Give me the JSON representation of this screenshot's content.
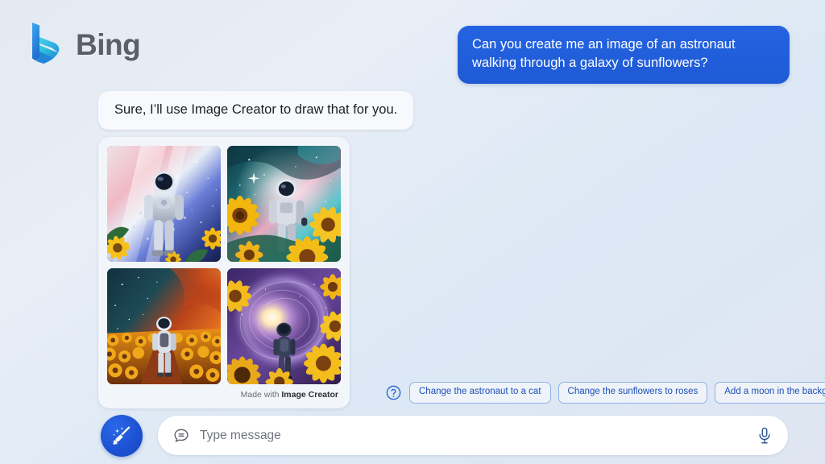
{
  "brand": {
    "name": "Bing",
    "logo_icon": "bing-b-logo"
  },
  "conversation": {
    "user_message": "Can you create me an image of an astronaut walking through a galaxy of sunflowers?",
    "bot_message": "Sure, I’ll use Image Creator to draw that for you."
  },
  "result_card": {
    "images": [
      {
        "alt": "astronaut-blue-pink-nebula-sunflowers",
        "palette": {
          "sky_a": "#f2e9ee",
          "sky_b": "#5566c8",
          "sky_c": "#1b2550",
          "accent": "#f5c518"
        }
      },
      {
        "alt": "astronaut-teal-pink-nebula-large-sunflowers",
        "palette": {
          "sky_a": "#12404a",
          "sky_b": "#52c3c9",
          "sky_c": "#e79ab8",
          "accent": "#f2b705"
        }
      },
      {
        "alt": "astronaut-orange-nebula-sunflower-field-path",
        "palette": {
          "sky_a": "#1c3a48",
          "sky_b": "#d9521a",
          "sky_c": "#7a1f10",
          "accent": "#f0a202"
        }
      },
      {
        "alt": "astronaut-purple-spiral-galaxy-portal-sunflowers",
        "palette": {
          "sky_a": "#4b2f79",
          "sky_b": "#b58adf",
          "sky_c": "#fdf4d8",
          "accent": "#f6c026"
        }
      }
    ],
    "footer_prefix": "Made with ",
    "footer_brand": "Image Creator"
  },
  "suggestions": {
    "help_icon": "question-circle-icon",
    "chips": [
      "Change the astronaut to a cat",
      "Change the sunflowers to roses",
      "Add a moon in the background"
    ]
  },
  "composer": {
    "new_topic_icon": "broom-sparkle-icon",
    "bubble_icon": "chat-bubble-icon",
    "mic_icon": "microphone-icon",
    "placeholder": "Type message",
    "value": ""
  },
  "colors": {
    "user_bubble": "#2463e0",
    "chip_border": "#8fb2e8",
    "chip_text": "#1c4fb5",
    "accent_blue": "#1b4fd0"
  }
}
